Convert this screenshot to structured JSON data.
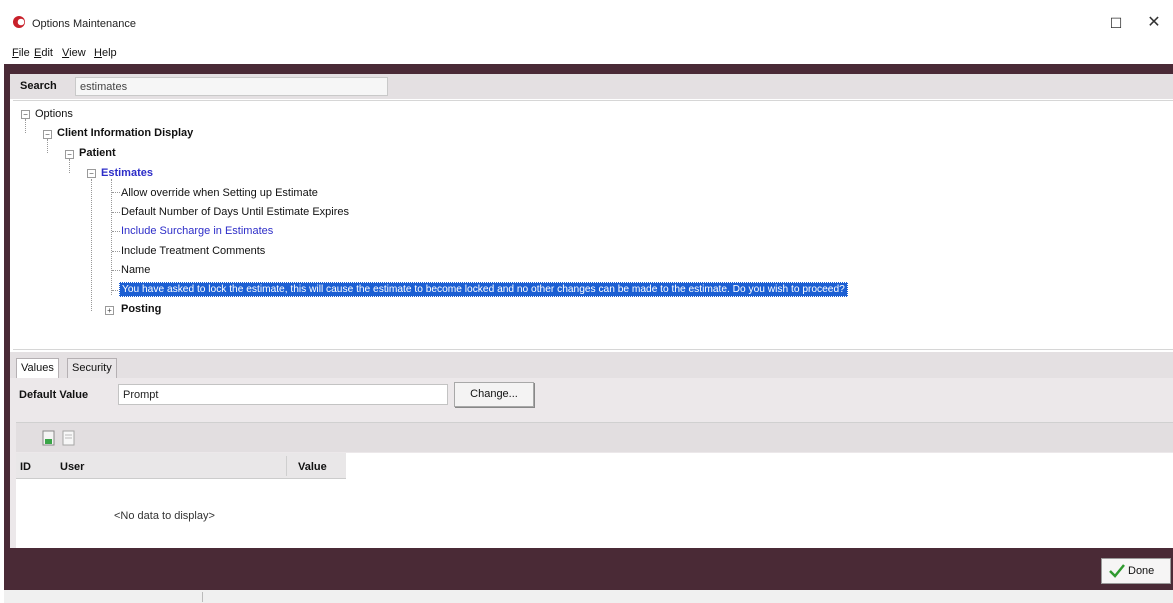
{
  "window": {
    "title": "Options Maintenance",
    "maximize_glyph": "☐",
    "close_glyph": "✕"
  },
  "menu": [
    {
      "label": "File",
      "accel": "F",
      "rest": "ile"
    },
    {
      "label": "Edit",
      "accel": "E",
      "rest": "dit"
    },
    {
      "label": "View",
      "accel": "V",
      "rest": "iew"
    },
    {
      "label": "Help",
      "accel": "H",
      "rest": "elp"
    }
  ],
  "search": {
    "label": "Search",
    "value": "estimates"
  },
  "tree": {
    "root": "Options",
    "level1": "Client Information Display",
    "level2": "Patient",
    "level3": "Estimates",
    "items": [
      "Allow override when Setting up Estimate",
      "Default Number of Days Until Estimate Expires",
      "Include Surcharge in Estimates",
      "Include Treatment Comments",
      "Name",
      "You have asked to lock the estimate, this will cause the estimate to become locked and no other changes can be made to the estimate. Do you wish to proceed?"
    ],
    "sibling": "Posting",
    "expand_glyphs": {
      "collapse": "−",
      "expand": "+"
    }
  },
  "tabs": {
    "values": "Values",
    "security": "Security"
  },
  "default_value": {
    "label": "Default Value",
    "value": "Prompt",
    "change_label": "Change..."
  },
  "toolbar": {
    "icons": [
      "add-record-icon",
      "delete-record-icon"
    ]
  },
  "grid": {
    "columns": [
      "ID",
      "User",
      "Value"
    ],
    "empty_text": "<No data to display>"
  },
  "done": {
    "label": "Done"
  },
  "colors": {
    "frame": "#4a2a36",
    "selection": "#1c5fd3",
    "link_blue": "#2d2dc8"
  }
}
